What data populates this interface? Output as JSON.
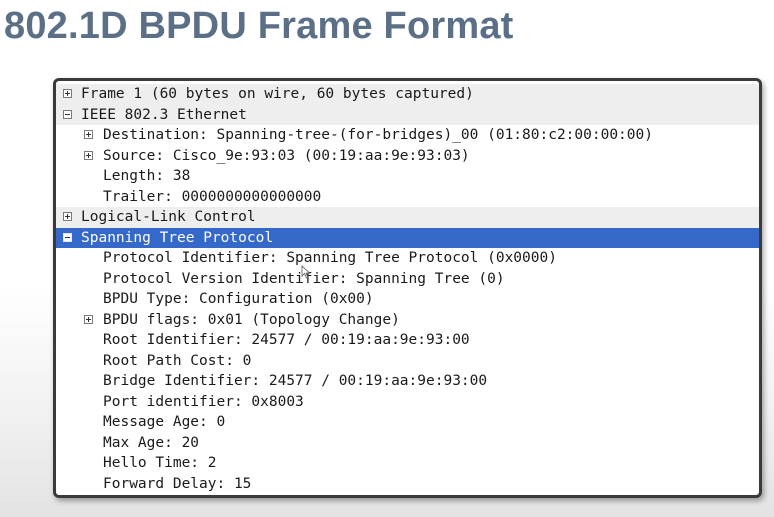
{
  "slide": {
    "title": "802.1D BPDU Frame Format"
  },
  "tree": {
    "frame": "Frame 1 (60 bytes on wire, 60 bytes captured)",
    "ethernet": {
      "label": "IEEE 802.3 Ethernet",
      "destination": "Destination: Spanning-tree-(for-bridges)_00 (01:80:c2:00:00:00)",
      "source": "Source: Cisco_9e:93:03 (00:19:aa:9e:93:03)",
      "length": "Length: 38",
      "trailer": "Trailer: 0000000000000000"
    },
    "llc": "Logical-Link Control",
    "stp": {
      "label": "Spanning Tree Protocol",
      "protocol_identifier": "Protocol Identifier: Spanning Tree Protocol (0x0000)",
      "protocol_version": "Protocol Version Identifier: Spanning Tree (0)",
      "bpdu_type": "BPDU Type: Configuration (0x00)",
      "bpdu_flags": "BPDU flags: 0x01 (Topology Change)",
      "root_identifier": "Root Identifier: 24577 / 00:19:aa:9e:93:00",
      "root_path_cost": "Root Path Cost: 0",
      "bridge_identifier": "Bridge Identifier: 24577 / 00:19:aa:9e:93:00",
      "port_identifier": "Port identifier: 0x8003",
      "message_age": "Message Age: 0",
      "max_age": "Max Age: 20",
      "hello_time": "Hello Time: 2",
      "forward_delay": "Forward Delay: 15"
    }
  },
  "colors": {
    "title": "#5b6f86",
    "selection": "#3569c9",
    "header_row": "#eeeeee"
  }
}
